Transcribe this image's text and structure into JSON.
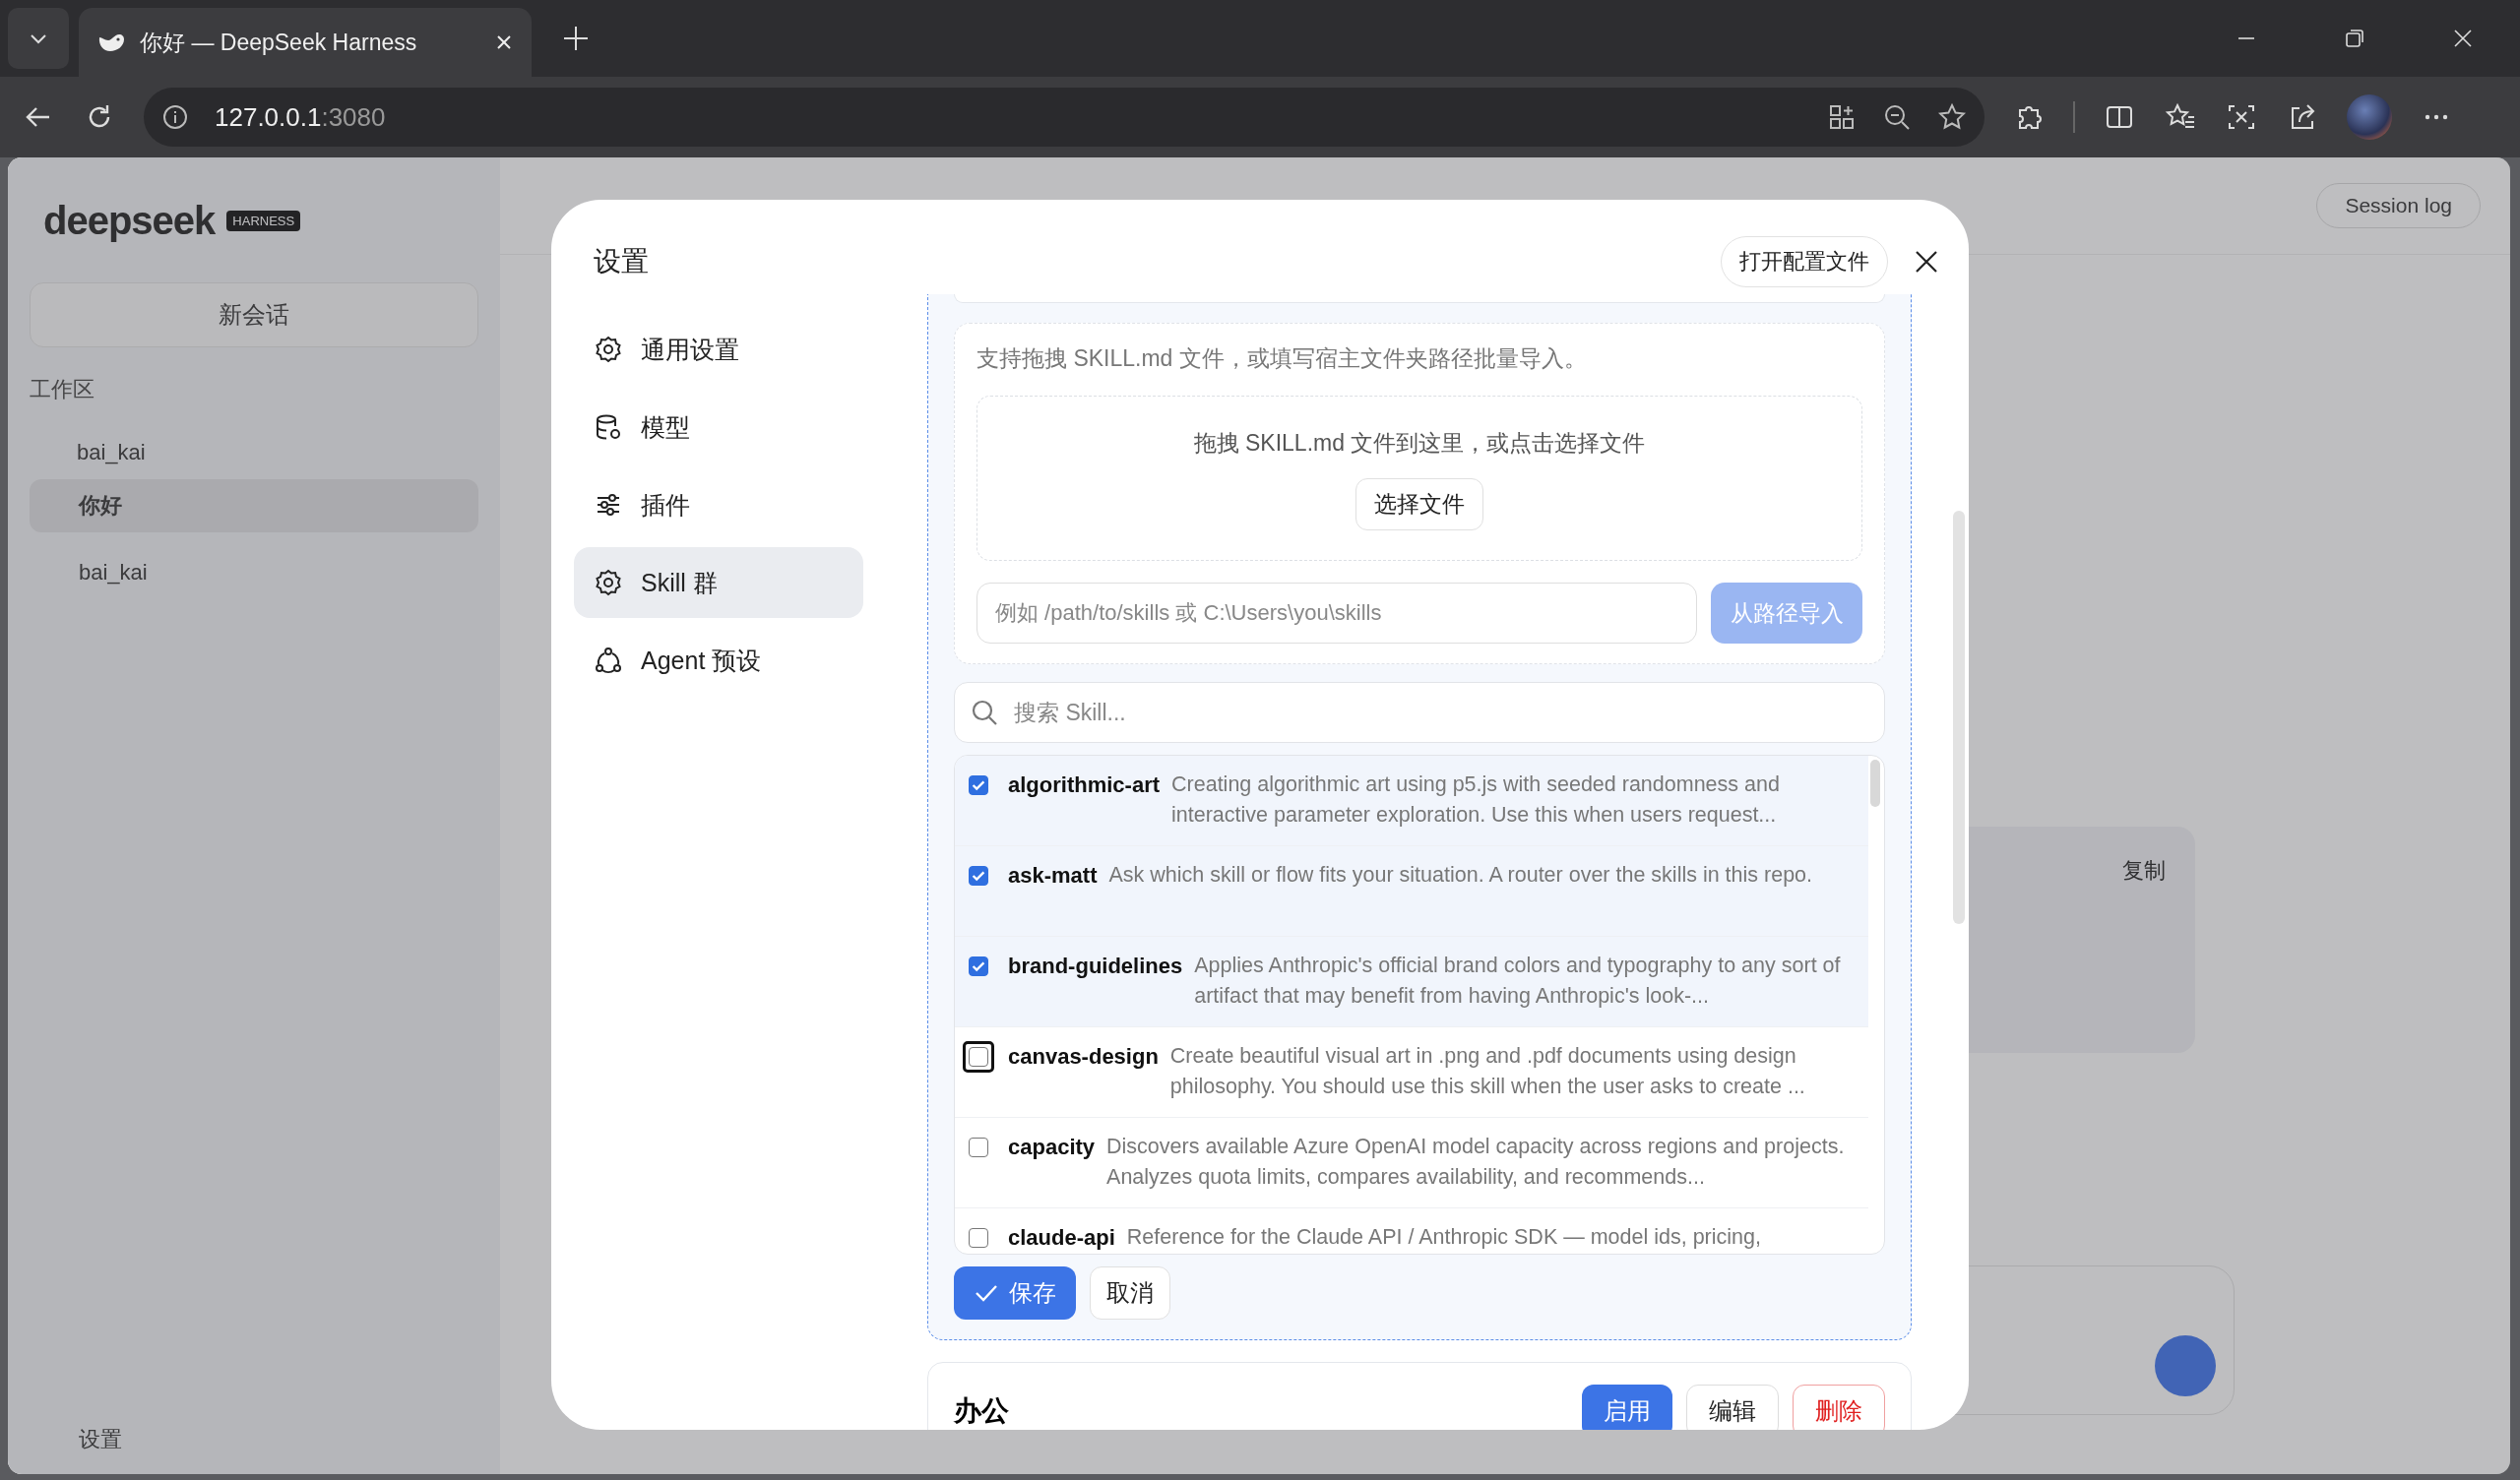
{
  "browser": {
    "tab_title": "你好 — DeepSeek Harness",
    "url_host": "127.0.0.1",
    "url_port": ":3080"
  },
  "background": {
    "logo": "deepseek",
    "badge": "HARNESS",
    "new_chat": "新会话",
    "workspace_label": "工作区",
    "folder": "bai_kai",
    "sessions": [
      {
        "title": "你好",
        "selected": true
      },
      {
        "title": "bai_kai",
        "selected": false
      }
    ],
    "settings": "设置",
    "session_log": "Session log",
    "copy_label": "复制"
  },
  "modal": {
    "title": "设置",
    "open_config_button": "打开配置文件",
    "nav": [
      {
        "label": "通用设置",
        "kind": "gear",
        "selected": false
      },
      {
        "label": "模型",
        "kind": "database",
        "selected": false
      },
      {
        "label": "插件",
        "kind": "sliders",
        "selected": false
      },
      {
        "label": "Skill 群",
        "kind": "gear",
        "selected": true
      },
      {
        "label": "Agent 预设",
        "kind": "agent",
        "selected": false
      }
    ],
    "import": {
      "hint": "支持拖拽 SKILL.md 文件，或填写宿主文件夹路径批量导入。",
      "drop_text": "拖拽 SKILL.md 文件到这里，或点击选择文件",
      "choose_button": "选择文件",
      "path_placeholder": "例如 /path/to/skills 或 C:\\Users\\you\\skills",
      "import_button": "从路径导入",
      "import_disabled": true
    },
    "search_placeholder": "搜索 Skill...",
    "skills": [
      {
        "name": "algorithmic-art",
        "description": "Creating algorithmic art using p5.js with seeded randomness and interactive parameter exploration. Use this when users request...",
        "checked": true,
        "focused": false
      },
      {
        "name": "ask-matt",
        "description": "Ask which skill or flow fits your situation. A router over the skills in this repo.",
        "checked": true,
        "focused": false
      },
      {
        "name": "brand-guidelines",
        "description": "Applies Anthropic's official brand colors and typography to any sort of artifact that may benefit from having Anthropic's look-...",
        "checked": true,
        "focused": false
      },
      {
        "name": "canvas-design",
        "description": "Create beautiful visual art in .png and .pdf documents using design philosophy. You should use this skill when the user asks to create ...",
        "checked": false,
        "focused": true
      },
      {
        "name": "capacity",
        "description": "Discovers available Azure OpenAI model capacity across regions and projects. Analyzes quota limits, compares availability, and recommends...",
        "checked": false,
        "focused": false
      },
      {
        "name": "claude-api",
        "description": "Reference for the Claude API / Anthropic SDK — model ids, pricing,",
        "checked": false,
        "focused": false
      }
    ],
    "save_button": "保存",
    "cancel_button": "取消",
    "group": {
      "title": "办公",
      "enable_button": "启用",
      "edit_button": "编辑",
      "delete_button": "删除"
    }
  }
}
